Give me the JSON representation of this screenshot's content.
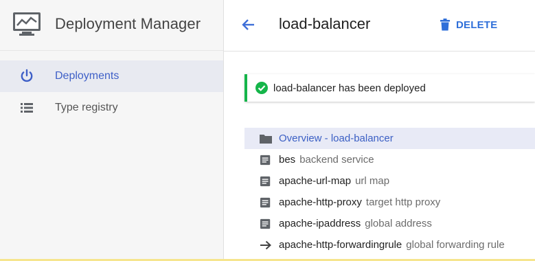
{
  "app": {
    "title": "Deployment Manager"
  },
  "sidebar": {
    "items": [
      {
        "label": "Deployments",
        "icon": "power-icon",
        "active": true
      },
      {
        "label": "Type registry",
        "icon": "list-icon",
        "active": false
      }
    ]
  },
  "header": {
    "title": "load-balancer",
    "delete_label": "DELETE"
  },
  "toast": {
    "message": "load-balancer has been deployed"
  },
  "tree": {
    "rows": [
      {
        "name": "Overview - load-balancer",
        "type": "",
        "icon": "folder-icon",
        "selected": true
      },
      {
        "name": "bes",
        "type": "backend service",
        "icon": "document-icon",
        "selected": false
      },
      {
        "name": "apache-url-map",
        "type": "url map",
        "icon": "document-icon",
        "selected": false
      },
      {
        "name": "apache-http-proxy",
        "type": "target http proxy",
        "icon": "document-icon",
        "selected": false
      },
      {
        "name": "apache-ipaddress",
        "type": "global address",
        "icon": "document-icon",
        "selected": false
      },
      {
        "name": "apache-http-forwardingrule",
        "type": "global forwarding rule",
        "icon": "arrow-right-icon",
        "selected": false
      }
    ]
  },
  "colors": {
    "accent": "#3e5fc7",
    "delete": "#2f6fd9",
    "success": "#15b54a"
  }
}
